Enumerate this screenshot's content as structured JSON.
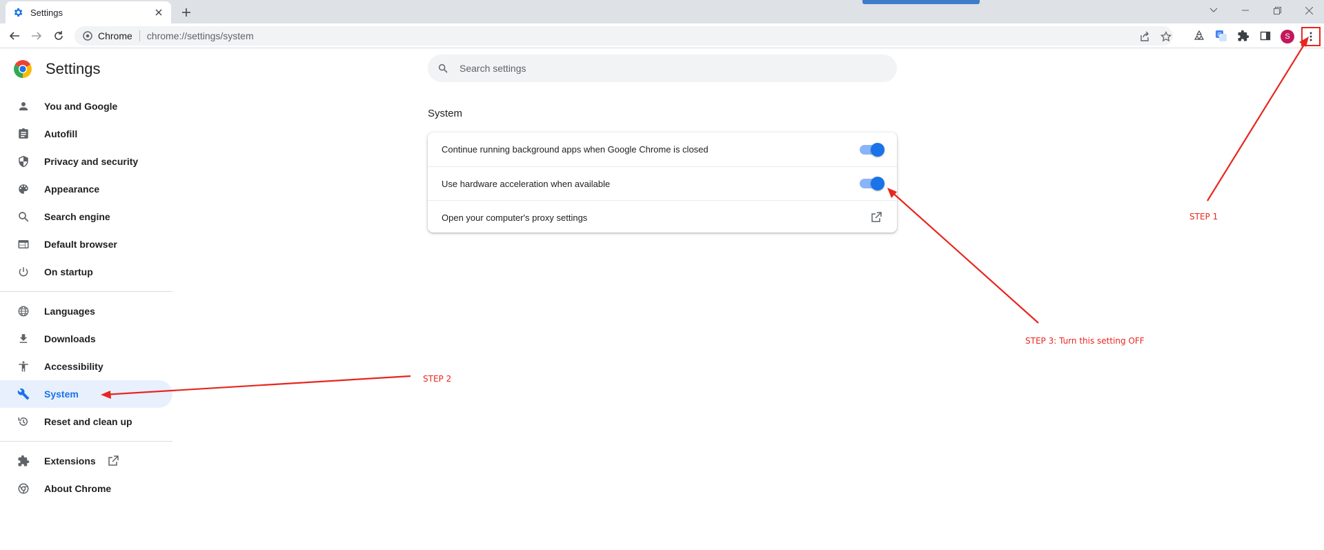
{
  "browser": {
    "tab_title": "Settings",
    "omnibox_chip": "Chrome",
    "url": "chrome://settings/system",
    "avatar_letter": "S"
  },
  "sidebar": {
    "title": "Settings",
    "items": [
      {
        "label": "You and Google",
        "icon": "person-icon"
      },
      {
        "label": "Autofill",
        "icon": "clipboard-icon"
      },
      {
        "label": "Privacy and security",
        "icon": "shield-icon"
      },
      {
        "label": "Appearance",
        "icon": "palette-icon"
      },
      {
        "label": "Search engine",
        "icon": "search-icon"
      },
      {
        "label": "Default browser",
        "icon": "browser-window-icon"
      },
      {
        "label": "On startup",
        "icon": "power-icon"
      },
      {
        "label": "Languages",
        "icon": "globe-icon"
      },
      {
        "label": "Downloads",
        "icon": "download-icon"
      },
      {
        "label": "Accessibility",
        "icon": "accessibility-icon"
      },
      {
        "label": "System",
        "icon": "wrench-icon",
        "active": true
      },
      {
        "label": "Reset and clean up",
        "icon": "history-icon"
      },
      {
        "label": "Extensions",
        "icon": "puzzle-icon"
      },
      {
        "label": "About Chrome",
        "icon": "chrome-icon"
      }
    ]
  },
  "search": {
    "placeholder": "Search settings"
  },
  "section": {
    "title": "System",
    "rows": [
      {
        "label": "Continue running background apps when Google Chrome is closed",
        "toggle_on": true
      },
      {
        "label": "Use hardware acceleration when available",
        "toggle_on": true
      },
      {
        "label": "Open your computer's proxy settings"
      }
    ]
  },
  "annotations": {
    "step1": "STEP 1",
    "step2": "STEP 2",
    "step3": "STEP 3: Turn this setting OFF",
    "color": "#e8251e"
  },
  "colors": {
    "accent": "#1a73e8",
    "active_bg": "#e8f0fe"
  }
}
